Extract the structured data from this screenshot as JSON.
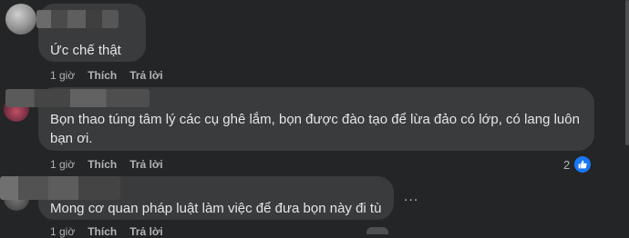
{
  "comments": [
    {
      "text_lines": [
        "Ức chế thật"
      ],
      "time": "1 giờ",
      "like_label": "Thích",
      "reply_label": "Trả lời"
    },
    {
      "text_lines": [
        "Bọn thao túng tâm lý các cụ ghê lắm, bọn được đào tạo để lừa đảo có lớp, có lang luôn",
        "bạn ơi."
      ],
      "time": "1 giờ",
      "like_label": "Thích",
      "reply_label": "Trả lời",
      "reaction_count": "2"
    },
    {
      "text_lines": [
        "Mong cơ quan pháp luật làm việc để đưa bọn này đi tù"
      ],
      "time": "1 giờ",
      "like_label": "Thích",
      "reply_label": "Trả lời",
      "more_label": "..."
    }
  ],
  "icons": {
    "like": "like-icon",
    "more": "more-options-icon"
  },
  "colors": {
    "background": "#242526",
    "bubble": "#3a3b3c",
    "text": "#e4e6eb",
    "secondary_text": "#b0b3b8",
    "like_blue": "#1877f2"
  }
}
